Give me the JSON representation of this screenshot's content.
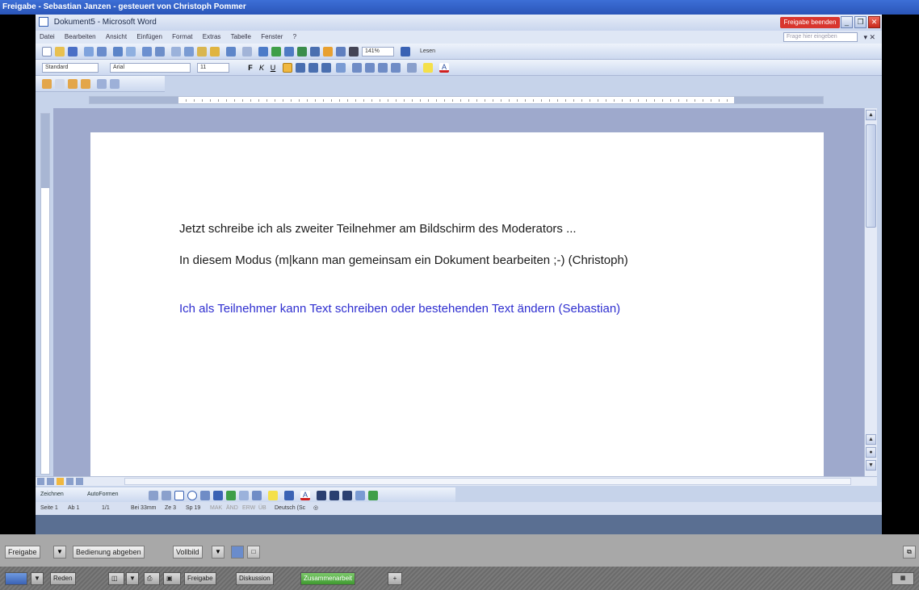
{
  "share": {
    "title": "Freigabe - Sebastian Janzen - gesteuert von Christoph Pommer",
    "stop_label": "Freigabe beenden",
    "controls": {
      "freigabe": "Freigabe",
      "bedienung": "Bedienung abgeben",
      "vollbild": "Vollbild"
    }
  },
  "word": {
    "title": "Dokument5 - Microsoft Word",
    "menu": [
      "Datei",
      "Bearbeiten",
      "Ansicht",
      "Einfügen",
      "Format",
      "Extras",
      "Tabelle",
      "Fenster",
      "?"
    ],
    "help_placeholder": "Frage hier eingeben",
    "toolbar": {
      "zoom": "141%",
      "style": "Standard",
      "font": "Arial",
      "size": "11",
      "lesen": "Lesen"
    },
    "document": {
      "line1": "Jetzt schreibe ich als  zweiter Teilnehmer am Bildschirm des Moderators ...",
      "line2": "In diesem Modus (m|kann man gemeinsam ein Dokument bearbeiten ;-) (Christoph)",
      "line3": "Ich als Teilnehmer kann Text schreiben oder bestehenden Text ändern (Sebastian)"
    },
    "drawbar": {
      "zeichnen": "Zeichnen",
      "autoformen": "AutoFormen"
    },
    "status": {
      "seite": "Seite 1",
      "ab": "Ab 1",
      "pages": "1/1",
      "bei": "Bei 33mm",
      "ze": "Ze 3",
      "sp": "Sp 19",
      "mak": "MAK",
      "aend": "ÄND",
      "erw": "ERW",
      "ub": "ÜB",
      "lang": "Deutsch (Sc"
    }
  },
  "taskbar": {
    "reden": "Reden",
    "freigabe": "Freigabe",
    "diskussion": "Diskussion",
    "zusammenarbeit": "Zusammenarbeit"
  },
  "colors": {
    "blue_text": "#2f2fd0",
    "stop_red": "#d8362e",
    "green": "#3f9a30"
  }
}
